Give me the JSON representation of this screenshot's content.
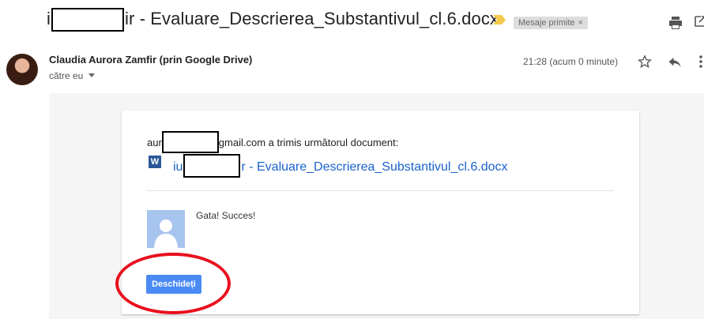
{
  "header": {
    "subject_start": "i",
    "subject_rest": "ir - Evaluare_Descrierea_Substantivul_cl.6.docx",
    "label": "Mesaje primite",
    "label_close": "×",
    "icons": [
      "importance-marker-icon",
      "print-icon",
      "open-new-window-icon"
    ]
  },
  "message": {
    "sender": "Claudia Aurora Zamfir (prin Google Drive)",
    "recipient": "către eu",
    "time": "21:28 (acum 0 minute)",
    "icons": [
      "star-icon",
      "reply-icon",
      "more-vert-icon",
      "chevron-down-icon"
    ]
  },
  "share_card": {
    "shared_prefix": "aur",
    "shared_suffix": "gmail.com a trimis următorul document:",
    "doc_icon_letter": "W",
    "doc_prefix": "iu",
    "doc_suffix": "r - Evaluare_Descrierea_Substantivul_cl.6.docx",
    "note": "Gata! Succes!",
    "open_button": "Deschideți"
  },
  "colors": {
    "link": "#1a62cf",
    "button": "#4a8af4",
    "annotation_circle": "#e8101d",
    "word_icon": "#2a5699"
  }
}
